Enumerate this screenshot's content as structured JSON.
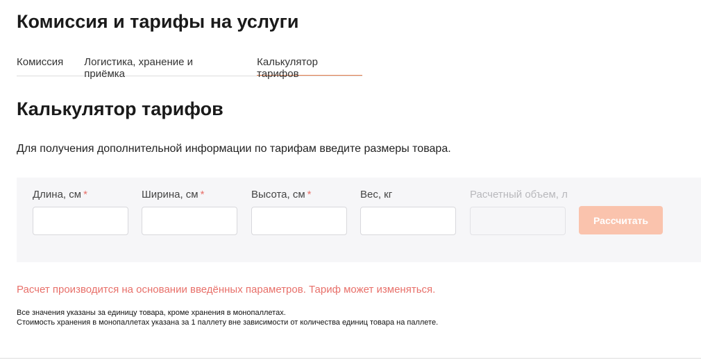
{
  "header": {
    "title": "Комиссия и тарифы на услуги"
  },
  "tabs": [
    {
      "label": "Комиссия"
    },
    {
      "label": "Логистика, хранение и приёмка"
    },
    {
      "label": "Калькулятор тарифов",
      "active": true
    }
  ],
  "calculator": {
    "title": "Калькулятор тарифов",
    "intro": "Для получения дополнительной информации по тарифам введите размеры товара.",
    "fields": [
      {
        "label": "Длина, см",
        "required": "*",
        "value": ""
      },
      {
        "label": "Ширина, см",
        "required": "*",
        "value": ""
      },
      {
        "label": "Высота, см",
        "required": "*",
        "value": ""
      },
      {
        "label": "Вес, кг",
        "value": ""
      },
      {
        "label": "Расчетный объем, л",
        "value": "",
        "disabled": true
      }
    ],
    "button_label": "Рассчитать",
    "warning": "Расчет производится на основании введённых параметров. Тариф может изменяться.",
    "notes": [
      "Все значения указаны за единицу товара, кроме хранения в монопаллетах.",
      "Стоимость хранения в монопаллетах указана за 1 паллету вне зависимости от количества единиц товара на паллете."
    ]
  },
  "colors": {
    "accent": "#e8804f",
    "button_disabled": "#fac3ad",
    "warning": "#e8706a",
    "panel_bg": "#f6f6f8"
  }
}
